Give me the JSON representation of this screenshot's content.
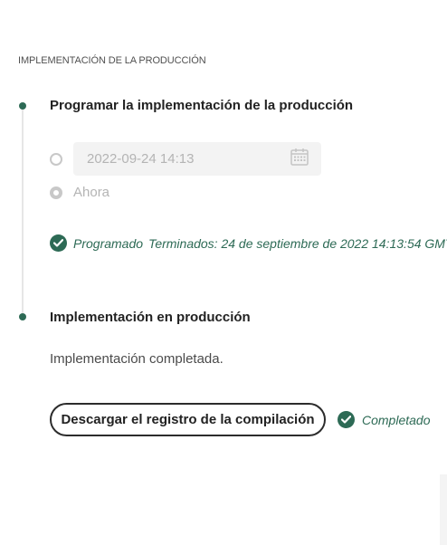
{
  "section": {
    "title": "IMPLEMENTACIÓN DE LA PRODUCCIÓN"
  },
  "step1": {
    "title": "Programar la implementación de la producción",
    "schedule_option": {
      "value": "2022-09-24 14:13",
      "icon": "calendar-icon"
    },
    "now_option": {
      "label": "Ahora"
    },
    "status": {
      "label": "Programado",
      "detail": "Terminados: 24 de septiembre de 2022 14:13:54 GMT",
      "icon": "check-circle-icon"
    }
  },
  "step2": {
    "title": "Implementación en producción",
    "message": "Implementación completada.",
    "download_label": "Descargar el registro de la compilación",
    "status": {
      "label": "Completado",
      "icon": "check-circle-icon"
    }
  },
  "colors": {
    "accent": "#2d6a55",
    "timeline": "#e6e6e6",
    "disabled_text": "#b4b4b4",
    "field_bg": "#f3f3f3"
  }
}
